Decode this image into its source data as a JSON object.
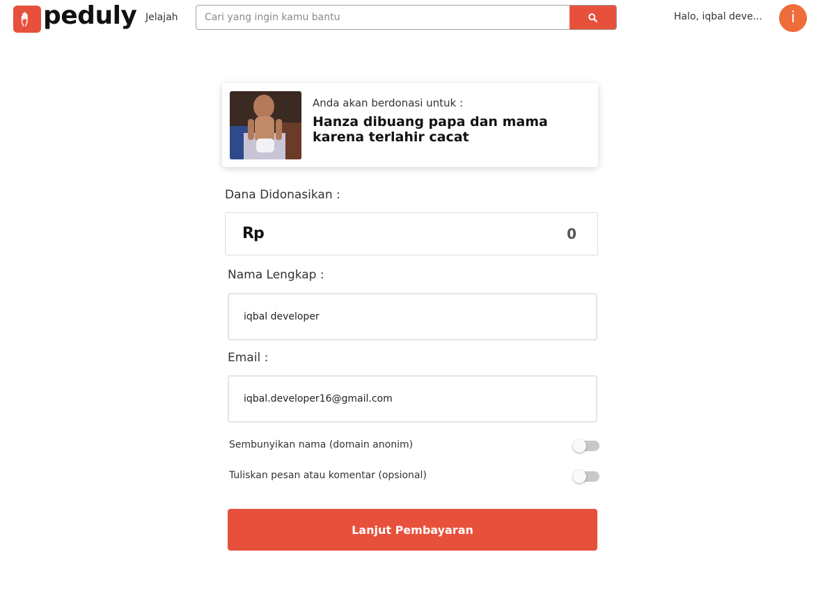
{
  "nav": {
    "brand": "peduly",
    "logo_icon": "hand-icon",
    "explore_link": "Jelajah",
    "search_placeholder": "Cari yang ingin kamu bantu",
    "search_icon": "search-icon",
    "greeting": "Halo, iqbal deve...",
    "avatar_initial": "i"
  },
  "campaign": {
    "label": "Anda akan berdonasi untuk :",
    "title": "Hanza dibuang papa dan mama karena terlahir cacat"
  },
  "form": {
    "amount_label": "Dana Didonasikan :",
    "currency": "Rp",
    "amount_value": "0",
    "name_label": "Nama Lengkap :",
    "name_value": "iqbal developer",
    "email_label": "Email :",
    "email_value": "iqbal.developer16@gmail.com",
    "toggles": [
      {
        "label": "Sembunyikan nama (domain anonim)",
        "on": false
      },
      {
        "label": "Tuliskan pesan atau komentar (opsional)",
        "on": false
      }
    ],
    "submit_label": "Lanjut Pembayaran"
  },
  "colors": {
    "accent": "#e7513b",
    "avatar": "#ef6c3b"
  }
}
